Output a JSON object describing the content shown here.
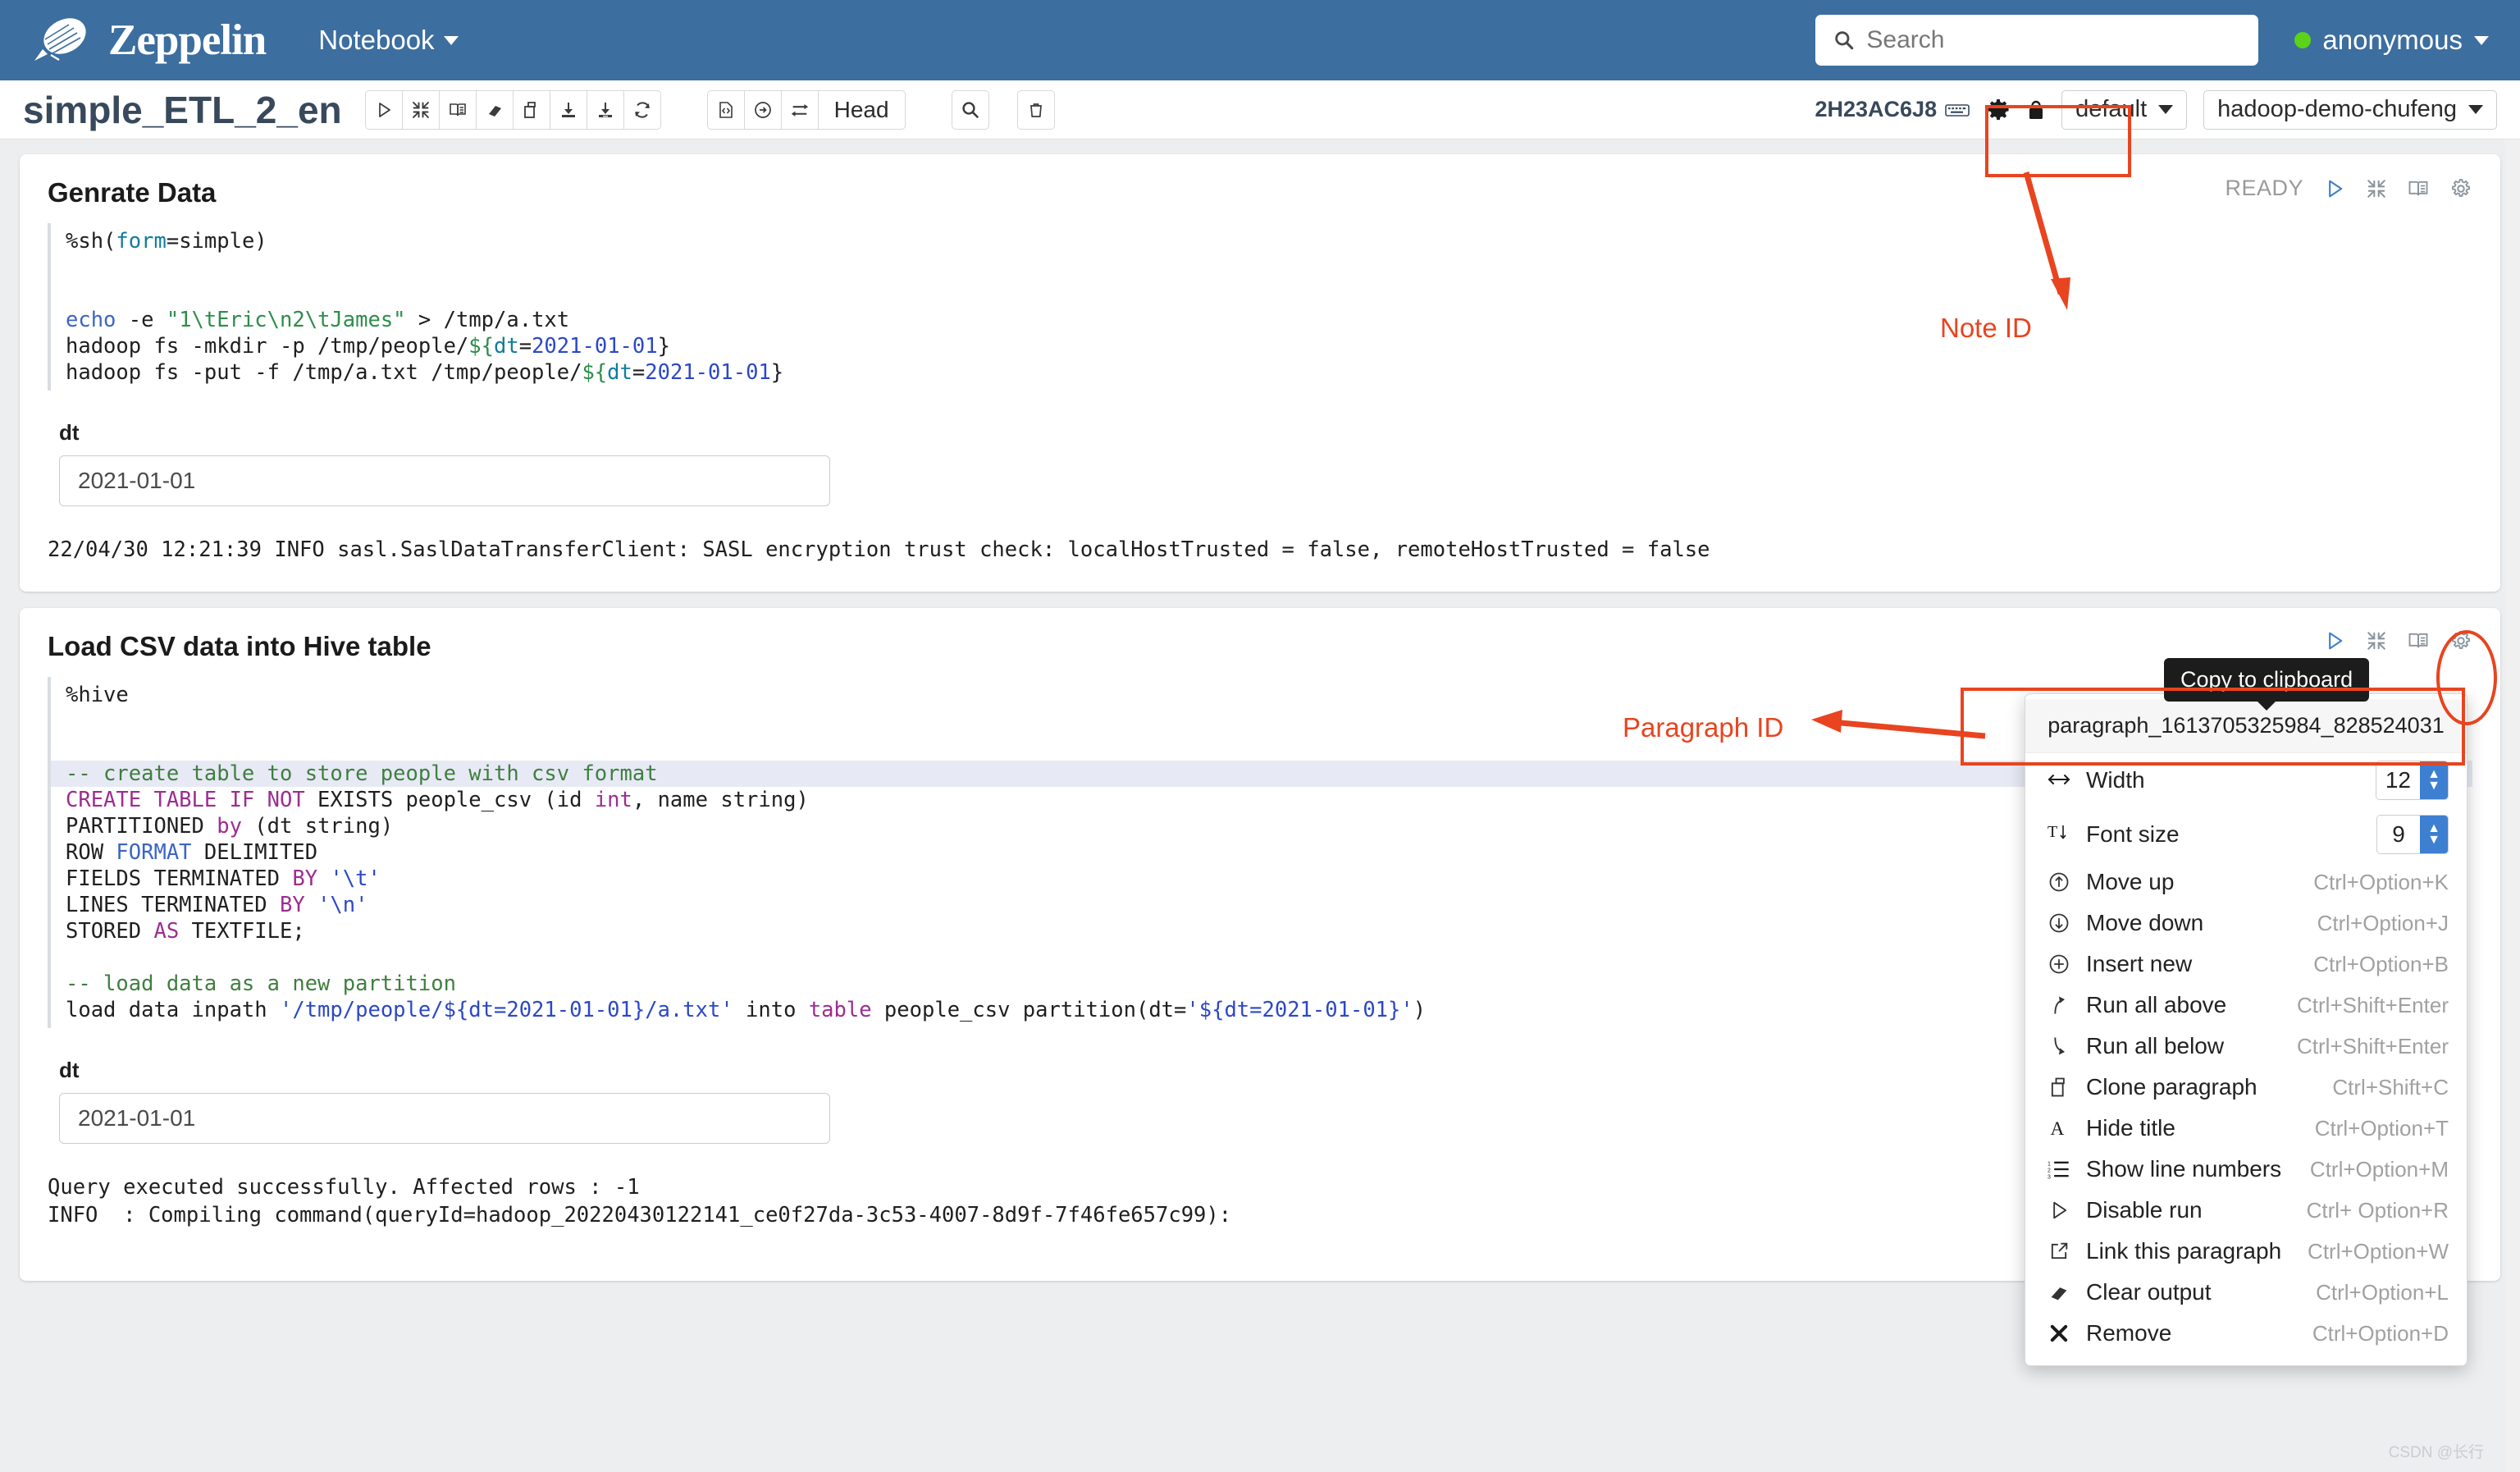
{
  "navbar": {
    "brand": "Zeppelin",
    "menu_label": "Notebook",
    "search_placeholder": "Search",
    "user": "anonymous"
  },
  "note_toolbar": {
    "title": "simple_ETL_2_en",
    "buttons": [
      {
        "name": "run-all-paragraphs",
        "icon": "play-icon"
      },
      {
        "name": "collapse-all",
        "icon": "collapse-icon"
      },
      {
        "name": "show-hide-code",
        "icon": "book-icon"
      },
      {
        "name": "clear-all-output",
        "icon": "eraser-icon"
      },
      {
        "name": "clone-note",
        "icon": "clone-icon"
      },
      {
        "name": "export-note",
        "icon": "download-icon"
      },
      {
        "name": "import-note",
        "icon": "download-alt-icon"
      },
      {
        "name": "reload-note",
        "icon": "refresh-icon"
      }
    ],
    "version_buttons": [
      {
        "name": "code-view",
        "icon": "code-file-icon"
      },
      {
        "name": "commit",
        "icon": "clock-arrow-icon"
      },
      {
        "name": "compare-revision",
        "icon": "swap-icon"
      }
    ],
    "head_label": "Head",
    "search_button": "search-icon",
    "trash_button": "trash-icon",
    "note_id": "2H23AC6J8",
    "keyboard_icon": "keyboard-icon",
    "gear_icon": "gear-icon",
    "lock_icon": "lock-icon",
    "permission_select": "default",
    "interpreter_select": "hadoop-demo-chufeng"
  },
  "paragraphs": [
    {
      "title": "Genrate Data",
      "status": "READY",
      "code_lines": [
        {
          "segments": [
            {
              "t": "%sh(",
              "c": "plain"
            },
            {
              "t": "form",
              "c": "k-cyan"
            },
            {
              "t": "=simple)",
              "c": "plain"
            }
          ]
        },
        {
          "segments": [
            {
              "t": "",
              "c": "plain"
            }
          ]
        },
        {
          "segments": [
            {
              "t": "",
              "c": "plain"
            }
          ]
        },
        {
          "segments": [
            {
              "t": "echo",
              "c": "k-fn"
            },
            {
              "t": " -e ",
              "c": "plain"
            },
            {
              "t": "\"1\\tEric\\n2\\tJames\"",
              "c": "k-str"
            },
            {
              "t": " > ",
              "c": "plain"
            },
            {
              "t": "/tmp/a.txt",
              "c": "plain"
            }
          ]
        },
        {
          "segments": [
            {
              "t": "hadoop fs -mkdir -p /tmp/people/",
              "c": "plain"
            },
            {
              "t": "${",
              "c": "k-str"
            },
            {
              "t": "dt",
              "c": "k-cyan"
            },
            {
              "t": "=",
              "c": "plain"
            },
            {
              "t": "2021-01-01",
              "c": "k-blue"
            },
            {
              "t": "}",
              "c": "plain"
            }
          ]
        },
        {
          "segments": [
            {
              "t": "hadoop fs -put -f /tmp/a.txt /tmp/people/",
              "c": "plain"
            },
            {
              "t": "${",
              "c": "k-str"
            },
            {
              "t": "dt",
              "c": "k-cyan"
            },
            {
              "t": "=",
              "c": "plain"
            },
            {
              "t": "2021-01-01",
              "c": "k-blue"
            },
            {
              "t": "}",
              "c": "plain"
            }
          ]
        }
      ],
      "form_label": "dt",
      "form_value": "2021-01-01",
      "output": "22/04/30 12:21:39 INFO sasl.SaslDataTransferClient: SASL encryption trust check: localHostTrusted = false, remoteHostTrusted = false"
    },
    {
      "title": "Load CSV data into Hive table",
      "status": "",
      "code_lines": [
        {
          "segments": [
            {
              "t": "%hive",
              "c": "plain"
            }
          ]
        },
        {
          "segments": [
            {
              "t": "",
              "c": "plain"
            }
          ]
        },
        {
          "segments": [
            {
              "t": "",
              "c": "plain"
            }
          ]
        },
        {
          "highlight": true,
          "segments": [
            {
              "t": "-- create table to store people with csv format",
              "c": "k-com"
            }
          ]
        },
        {
          "segments": [
            {
              "t": "CREATE TABLE IF NOT",
              "c": "k-kw"
            },
            {
              "t": " EXISTS people_csv (id ",
              "c": "plain"
            },
            {
              "t": "int",
              "c": "k-kw"
            },
            {
              "t": ", name string)",
              "c": "plain"
            }
          ]
        },
        {
          "segments": [
            {
              "t": "PARTITIONED ",
              "c": "plain"
            },
            {
              "t": "by",
              "c": "k-kw"
            },
            {
              "t": " (dt string)",
              "c": "plain"
            }
          ]
        },
        {
          "segments": [
            {
              "t": "ROW ",
              "c": "plain"
            },
            {
              "t": "FORMAT",
              "c": "k-fn"
            },
            {
              "t": " DELIMITED",
              "c": "plain"
            }
          ]
        },
        {
          "segments": [
            {
              "t": "FIELDS TERMINATED ",
              "c": "plain"
            },
            {
              "t": "BY",
              "c": "k-kw"
            },
            {
              "t": " ",
              "c": "plain"
            },
            {
              "t": "'\\t'",
              "c": "k-blue"
            }
          ]
        },
        {
          "segments": [
            {
              "t": "LINES TERMINATED ",
              "c": "plain"
            },
            {
              "t": "BY",
              "c": "k-kw"
            },
            {
              "t": " ",
              "c": "plain"
            },
            {
              "t": "'\\n'",
              "c": "k-blue"
            }
          ]
        },
        {
          "segments": [
            {
              "t": "STORED ",
              "c": "plain"
            },
            {
              "t": "AS",
              "c": "k-kw"
            },
            {
              "t": " TEXTFILE;",
              "c": "plain"
            }
          ]
        },
        {
          "segments": [
            {
              "t": "",
              "c": "plain"
            }
          ]
        },
        {
          "segments": [
            {
              "t": "-- load data as a new partition",
              "c": "k-com"
            }
          ]
        },
        {
          "segments": [
            {
              "t": "load data inpath ",
              "c": "plain"
            },
            {
              "t": "'/tmp/people/${dt=2021-01-01}/a.txt'",
              "c": "k-blue"
            },
            {
              "t": " into ",
              "c": "plain"
            },
            {
              "t": "table",
              "c": "k-kw"
            },
            {
              "t": " people_csv partition(dt=",
              "c": "plain"
            },
            {
              "t": "'${dt=2021-01-01}'",
              "c": "k-blue"
            },
            {
              "t": ")",
              "c": "plain"
            }
          ]
        }
      ],
      "form_label": "dt",
      "form_value": "2021-01-01",
      "output": "Query executed successfully. Affected rows : -1\nINFO  : Compiling command(queryId=hadoop_20220430122141_ce0f27da-3c53-4007-8d9f-7f46fe657c99):"
    }
  ],
  "tooltip": "Copy to clipboard",
  "context_menu": {
    "paragraph_id": "paragraph_1613705325984_828524031",
    "width": {
      "label": "Width",
      "value": "12",
      "icon": "arrows-horizontal-icon"
    },
    "font_size": {
      "label": "Font size",
      "value": "9",
      "icon": "text-size-icon"
    },
    "items": [
      {
        "icon": "arrow-up-circle-icon",
        "label": "Move up",
        "shortcut": "Ctrl+Option+K"
      },
      {
        "icon": "arrow-down-circle-icon",
        "label": "Move down",
        "shortcut": "Ctrl+Option+J"
      },
      {
        "icon": "plus-circle-icon",
        "label": "Insert new",
        "shortcut": "Ctrl+Option+B"
      },
      {
        "icon": "run-above-icon",
        "label": "Run all above",
        "shortcut": "Ctrl+Shift+Enter"
      },
      {
        "icon": "run-below-icon",
        "label": "Run all below",
        "shortcut": "Ctrl+Shift+Enter"
      },
      {
        "icon": "clone-icon",
        "label": "Clone paragraph",
        "shortcut": "Ctrl+Shift+C"
      },
      {
        "icon": "letter-a-icon",
        "label": "Hide title",
        "shortcut": "Ctrl+Option+T"
      },
      {
        "icon": "list-numbered-icon",
        "label": "Show line numbers",
        "shortcut": "Ctrl+Option+M"
      },
      {
        "icon": "play-outline-icon",
        "label": "Disable run",
        "shortcut": "Ctrl+ Option+R"
      },
      {
        "icon": "external-link-icon",
        "label": "Link this paragraph",
        "shortcut": "Ctrl+Option+W"
      },
      {
        "icon": "eraser-icon",
        "label": "Clear output",
        "shortcut": "Ctrl+Option+L"
      },
      {
        "icon": "close-x-icon",
        "label": "Remove",
        "shortcut": "Ctrl+Option+D"
      }
    ]
  },
  "annotations": {
    "note_id_label": "Note ID",
    "paragraph_id_label": "Paragraph ID",
    "accent_color": "#e8441f"
  },
  "watermark": "CSDN @长行"
}
